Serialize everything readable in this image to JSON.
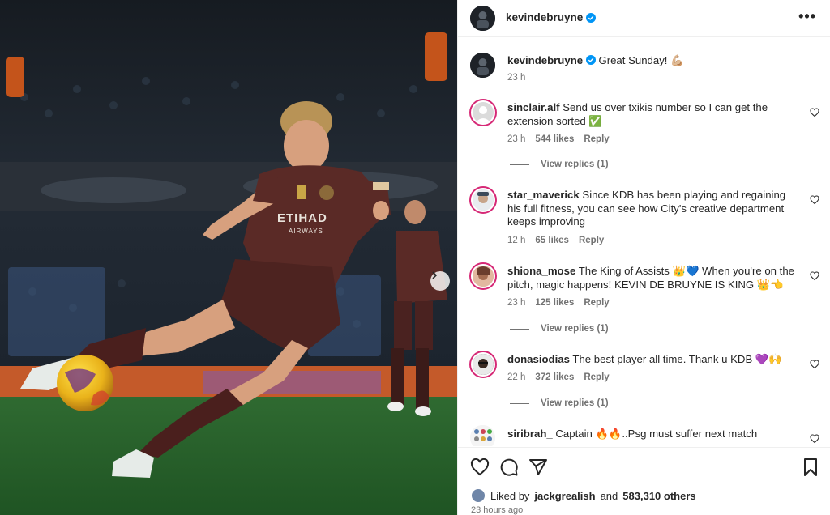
{
  "post": {
    "username": "kevindebruyne",
    "caption": "Great Sunday! 💪🏼",
    "caption_time": "23 h"
  },
  "comments": [
    {
      "username": "sinclair.alf",
      "text": "Send us over txikis number so I can get the extension sorted ✅",
      "time": "23 h",
      "likes": "544 likes",
      "reply": "Reply",
      "view_replies": "View replies (1)"
    },
    {
      "username": "star_maverick",
      "text": "Since KDB has been playing and regaining his full fitness, you can see how City's creative department keeps improving",
      "time": "12 h",
      "likes": "65 likes",
      "reply": "Reply"
    },
    {
      "username": "shiona_mose",
      "text": "The King of Assists 👑💙 When you're on the pitch, magic happens! KEVIN DE BRUYNE IS KING 👑👈",
      "time": "23 h",
      "likes": "125 likes",
      "reply": "Reply",
      "view_replies": "View replies (1)"
    },
    {
      "username": "donasiodias",
      "text": "The best player all time. Thank u KDB 💜🙌",
      "time": "22 h",
      "likes": "372 likes",
      "reply": "Reply",
      "view_replies": "View replies (1)"
    },
    {
      "username": "siribrah_",
      "text": "Captain 🔥🔥..Psg must suffer next match"
    }
  ],
  "footer": {
    "liked_prefix": "Liked by",
    "liked_user": "jackgrealish",
    "liked_and": "and",
    "liked_others": "583,310 others",
    "posted": "23 hours ago"
  },
  "photo": {
    "sponsor_text": "ETIHAD",
    "sponsor_sub": "AIRWAYS"
  },
  "icons": [
    "verified-badge-icon",
    "more-options-icon",
    "heart-icon",
    "comment-icon",
    "share-icon",
    "bookmark-icon",
    "chevron-right-icon"
  ],
  "colors": {
    "verified": "#0095f6",
    "story_ring": "#d62976",
    "muted_text": "#737373",
    "jersey": "#5a2a26"
  }
}
